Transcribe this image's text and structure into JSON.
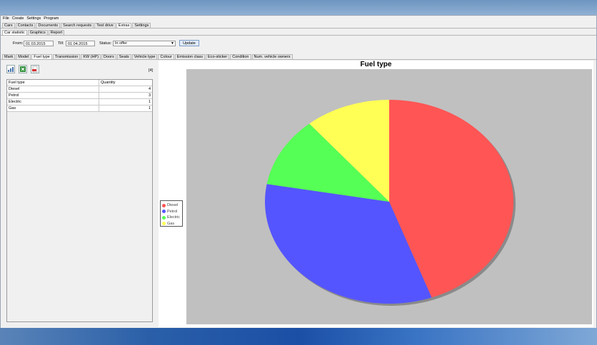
{
  "menu": [
    "File",
    "Create",
    "Settings",
    "Program"
  ],
  "main_tabs": [
    {
      "label": "Cars",
      "active": false
    },
    {
      "label": "Contacts",
      "active": false
    },
    {
      "label": "Documents",
      "active": false
    },
    {
      "label": "Search requests",
      "active": false
    },
    {
      "label": "Test drive",
      "active": false
    },
    {
      "label": "Extras",
      "active": true
    },
    {
      "label": "Settings",
      "active": false
    }
  ],
  "sub_tabs": [
    {
      "label": "Car statistic",
      "active": true
    },
    {
      "label": "Graphics",
      "active": false
    },
    {
      "label": "Report",
      "active": false
    }
  ],
  "filters": {
    "from_label": "From:",
    "from_value": "01.03.2015",
    "till_label": "Till:",
    "till_value": "01.04.2015",
    "status_label": "Status:",
    "status_value": "In offer",
    "update_label": "Update"
  },
  "stat_tabs": [
    {
      "label": "Mark",
      "active": false
    },
    {
      "label": "Model",
      "active": false
    },
    {
      "label": "Fuel type",
      "active": true
    },
    {
      "label": "Transmission",
      "active": false
    },
    {
      "label": "KW (HP)",
      "active": false
    },
    {
      "label": "Doors",
      "active": false
    },
    {
      "label": "Seats",
      "active": false
    },
    {
      "label": "Vehicle type",
      "active": false
    },
    {
      "label": "Colour",
      "active": false
    },
    {
      "label": "Emission class",
      "active": false
    },
    {
      "label": "Eco-sticker",
      "active": false
    },
    {
      "label": "Condition",
      "active": false
    },
    {
      "label": "Num. vehicle owners",
      "active": false
    }
  ],
  "toolbar": {
    "icons": [
      "export-chart-icon",
      "export-excel-icon",
      "export-pdf-icon"
    ],
    "count_label": "[4]"
  },
  "table": {
    "headers": [
      "Fuel type",
      "Quantity"
    ],
    "rows": [
      [
        "Diesel",
        "4"
      ],
      [
        "Petrol",
        "3"
      ],
      [
        "Electric",
        "1"
      ],
      [
        "Gas",
        "1"
      ]
    ]
  },
  "chart_data": {
    "type": "pie",
    "title": "Fuel type",
    "labels": [
      "Diesel",
      "Petrol",
      "Electric",
      "Gas"
    ],
    "values": [
      4,
      3,
      1,
      1
    ],
    "colors": [
      "#ff5555",
      "#5555ff",
      "#55ff55",
      "#ffff55"
    ],
    "legend": "left"
  }
}
